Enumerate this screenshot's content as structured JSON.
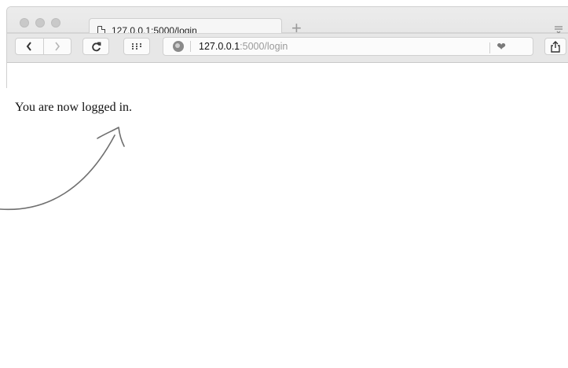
{
  "browser": {
    "tab": {
      "title": "127.0.0.1:5000/login"
    },
    "new_tab_label": "+",
    "url": {
      "host": "127.0.0.1",
      "rest": ":5000/login"
    },
    "icons": {
      "page": "page-icon",
      "back": "chevron-left-icon",
      "forward": "chevron-right-icon",
      "reload": "reload-icon",
      "top_sites": "grid-icon",
      "site_info": "globe-icon",
      "favorite": "heart-icon",
      "share": "share-icon",
      "tab_menu": "tab-menu-icon"
    }
  },
  "page": {
    "message": "You are now logged in."
  },
  "annotation": {
    "type": "hand-drawn-arrow",
    "color": "#6f6f6f"
  }
}
